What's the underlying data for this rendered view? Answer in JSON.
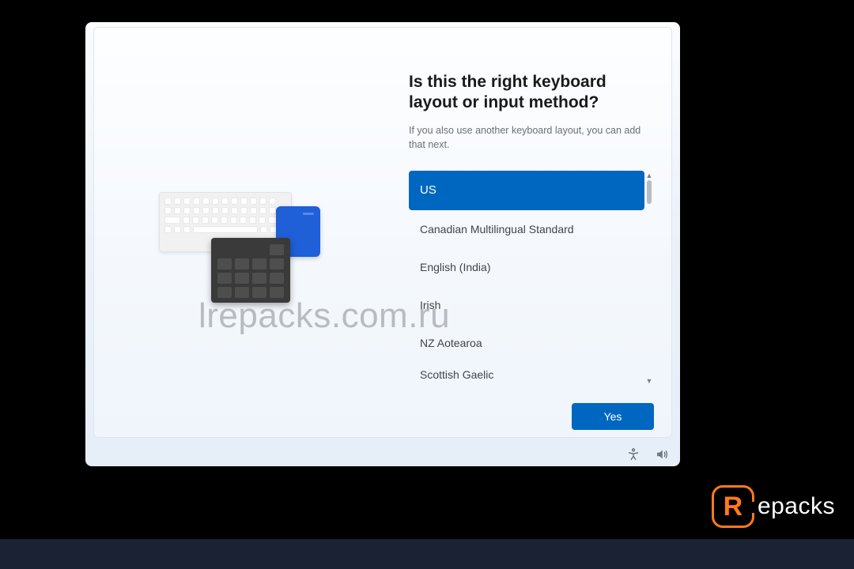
{
  "title": "Is this the right keyboard layout or input method?",
  "subtitle": "If you also use another keyboard layout, you can add that next.",
  "layouts": [
    "US",
    "Canadian Multilingual Standard",
    "English (India)",
    "Irish",
    "NZ Aotearoa",
    "Scottish Gaelic"
  ],
  "selected_index": 0,
  "yes_label": "Yes",
  "watermark": "lrepacks.com.ru",
  "brand": "epacks"
}
